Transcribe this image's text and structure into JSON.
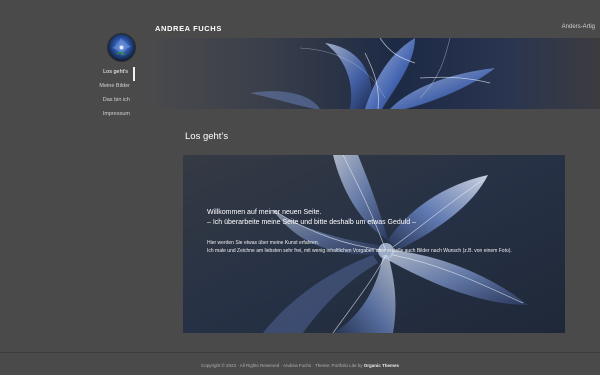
{
  "header": {
    "site_title": "ANDREA FUCHS",
    "tagline": "Anders-Artig"
  },
  "nav": {
    "items": [
      {
        "label": "Los geht's",
        "active": true
      },
      {
        "label": "Meine Bilder",
        "active": false
      },
      {
        "label": "Das bin ich",
        "active": false
      },
      {
        "label": "Impressum",
        "active": false
      }
    ]
  },
  "main": {
    "page_title": "Los geht’s",
    "hero": {
      "heading": "Willkommen auf meiner neuen Seite.",
      "subheading": "– Ich überarbeite meine Seite und bitte deshalb um etwas Geduld –",
      "body_1": "Hier werden Sie etwas über meine Kunst erfahren.",
      "body_2": "Ich male und Zeichne am liebsten sehr frei, mit wenig inhaltlichen Vorgaben aber erstelle auch Bilder nach Wunsch (z.B. von einem Foto)."
    }
  },
  "footer": {
    "text": "Copyright © 2023 · All Rights Reserved · Andrea Fuchs · Theme: Portfolio Lite by",
    "theme_author": "Organic Themes"
  },
  "colors": {
    "background": "#4a4a4a",
    "text": "#ffffff",
    "artwork_blue": "#4a6fb8"
  }
}
